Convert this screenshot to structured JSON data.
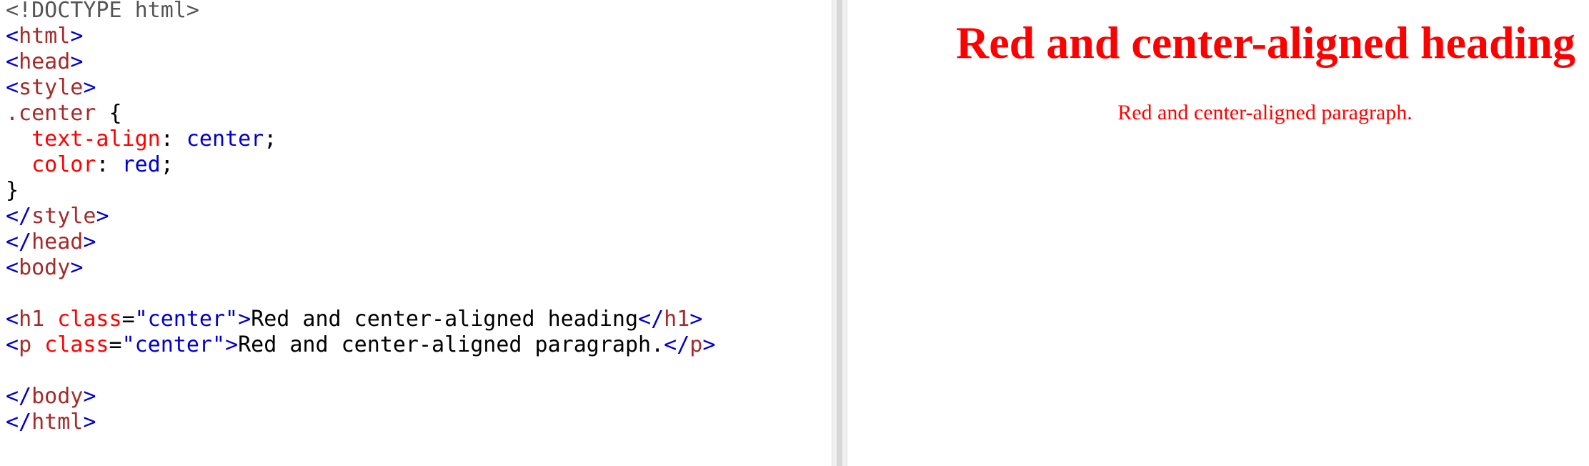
{
  "editor": {
    "lines": [
      [
        {
          "t": "<!DOCTYPE html>",
          "k": "doctype"
        }
      ],
      [
        {
          "t": "<",
          "k": "bracket"
        },
        {
          "t": "html",
          "k": "tag"
        },
        {
          "t": ">",
          "k": "bracket"
        }
      ],
      [
        {
          "t": "<",
          "k": "bracket"
        },
        {
          "t": "head",
          "k": "tag"
        },
        {
          "t": ">",
          "k": "bracket"
        }
      ],
      [
        {
          "t": "<",
          "k": "bracket"
        },
        {
          "t": "style",
          "k": "tag"
        },
        {
          "t": ">",
          "k": "bracket"
        }
      ],
      [
        {
          "t": ".center",
          "k": "sel"
        },
        {
          "t": " {",
          "k": "text"
        }
      ],
      [
        {
          "t": "  ",
          "k": "text"
        },
        {
          "t": "text-align",
          "k": "prop"
        },
        {
          "t": ": ",
          "k": "text"
        },
        {
          "t": "center",
          "k": "pval"
        },
        {
          "t": ";",
          "k": "text"
        }
      ],
      [
        {
          "t": "  ",
          "k": "text"
        },
        {
          "t": "color",
          "k": "prop"
        },
        {
          "t": ": ",
          "k": "text"
        },
        {
          "t": "red",
          "k": "pval"
        },
        {
          "t": ";",
          "k": "text"
        }
      ],
      [
        {
          "t": "}",
          "k": "text"
        }
      ],
      [
        {
          "t": "</",
          "k": "bracket"
        },
        {
          "t": "style",
          "k": "tag"
        },
        {
          "t": ">",
          "k": "bracket"
        }
      ],
      [
        {
          "t": "</",
          "k": "bracket"
        },
        {
          "t": "head",
          "k": "tag"
        },
        {
          "t": ">",
          "k": "bracket"
        }
      ],
      [
        {
          "t": "<",
          "k": "bracket"
        },
        {
          "t": "body",
          "k": "tag"
        },
        {
          "t": ">",
          "k": "bracket"
        }
      ],
      [],
      [
        {
          "t": "<",
          "k": "bracket"
        },
        {
          "t": "h1",
          "k": "tag"
        },
        {
          "t": " ",
          "k": "text"
        },
        {
          "t": "class",
          "k": "attr"
        },
        {
          "t": "=",
          "k": "text"
        },
        {
          "t": "\"center\"",
          "k": "value"
        },
        {
          "t": ">",
          "k": "bracket"
        },
        {
          "t": "Red and center-aligned heading",
          "k": "text"
        },
        {
          "t": "</",
          "k": "bracket"
        },
        {
          "t": "h1",
          "k": "tag"
        },
        {
          "t": ">",
          "k": "bracket"
        }
      ],
      [
        {
          "t": "<",
          "k": "bracket"
        },
        {
          "t": "p",
          "k": "tag"
        },
        {
          "t": " ",
          "k": "text"
        },
        {
          "t": "class",
          "k": "attr"
        },
        {
          "t": "=",
          "k": "text"
        },
        {
          "t": "\"center\"",
          "k": "value"
        },
        {
          "t": ">",
          "k": "bracket"
        },
        {
          "t": "Red and center-aligned paragraph.",
          "k": "text"
        },
        {
          "t": "</",
          "k": "bracket"
        },
        {
          "t": "p",
          "k": "tag"
        },
        {
          "t": ">",
          "k": "bracket"
        }
      ],
      [],
      [
        {
          "t": "</",
          "k": "bracket"
        },
        {
          "t": "body",
          "k": "tag"
        },
        {
          "t": ">",
          "k": "bracket"
        }
      ],
      [
        {
          "t": "</",
          "k": "bracket"
        },
        {
          "t": "html",
          "k": "tag"
        },
        {
          "t": ">",
          "k": "bracket"
        }
      ]
    ]
  },
  "preview": {
    "heading": "Red and center-aligned heading",
    "paragraph": "Red and center-aligned paragraph."
  },
  "colors": {
    "doctype": "#555555",
    "bracket": "#0000cd",
    "tag": "#a52a2a",
    "attr": "#ff0000",
    "value": "#0000cd",
    "output_text": "#ff0000"
  }
}
